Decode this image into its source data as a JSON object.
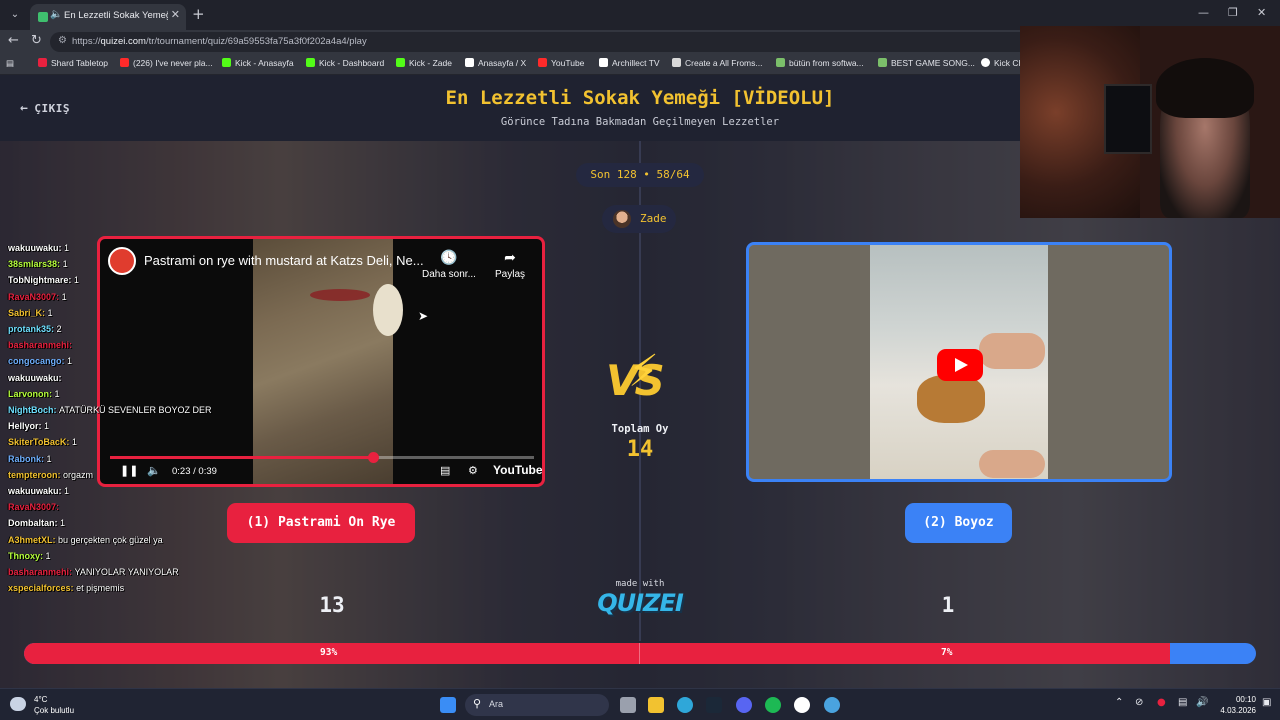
{
  "browser": {
    "tab_title": "En Lezzetli Sokak Yemeği [VİDEOLU]",
    "url_prefix": "https://",
    "url_host": "quizei.com",
    "url_path": "/tr/tournament/quiz/69a59553fa75a3f0f202a4a4/play",
    "bookmarks": [
      "Shard Tabletop",
      "(226) I've never pla...",
      "Kick - Anasayfa",
      "Kick - Dashboard",
      "Kick - Zade",
      "Anasayfa / X",
      "YouTube",
      "Archillect TV",
      "Create a All Froms...",
      "bütün from softwa...",
      "BEST GAME SONG...",
      "Kick Ch"
    ]
  },
  "header": {
    "exit_label": "ÇIKIŞ",
    "title": "En Lezzetli Sokak Yemeği [VİDEOLU]",
    "subtitle": "Görünce Tadına Bakmadan Geçilmeyen Lezzetler"
  },
  "round": {
    "label": "Son 128 • 58/64"
  },
  "user": {
    "name": "Zade"
  },
  "vs": {
    "label": "VS",
    "total_label": "Toplam Oy",
    "total_value": "14"
  },
  "left": {
    "video_title": "Pastrami on rye with mustard at Katzs Deli, Ne...",
    "later_label": "Daha sonr...",
    "share_label": "Paylaş",
    "time": "0:23 / 0:39",
    "progress": 0.62,
    "yt_label": "YouTube",
    "choice_label": "(1) Pastrami On Rye",
    "votes": "13",
    "percent": "93%",
    "color": "#e8213f"
  },
  "right": {
    "choice_label": "(2) Boyoz",
    "votes": "1",
    "percent": "7%",
    "color": "#3b82f6"
  },
  "result": {
    "left_fraction": 0.93
  },
  "branding": {
    "made_with": "made with",
    "logo": "QUIZEI"
  },
  "chat": [
    {
      "user": "wakuuwaku:",
      "msg": "1",
      "color": "#ffffff"
    },
    {
      "user": "38smlars38:",
      "msg": "1",
      "color": "#b6ff3c"
    },
    {
      "user": "TobNightmare:",
      "msg": "1",
      "color": "#ffffff"
    },
    {
      "user": "RavaN3007:",
      "msg": "1",
      "color": "#e8213f"
    },
    {
      "user": "Sabri_K:",
      "msg": "1",
      "color": "#f2c230"
    },
    {
      "user": "protank35:",
      "msg": "2",
      "color": "#6fe0ff"
    },
    {
      "user": "basharanmehi:",
      "msg": "",
      "color": "#e8213f"
    },
    {
      "user": "congocango:",
      "msg": "1",
      "color": "#6fb0ff"
    },
    {
      "user": "wakuuwaku:",
      "msg": "",
      "color": "#ffffff"
    },
    {
      "user": "Larvonon:",
      "msg": "1",
      "color": "#b6ff3c"
    },
    {
      "user": "NightBoch:",
      "msg": "ATATÜRKÜ SEVENLER BOYOZ DER",
      "color": "#6fe0ff"
    },
    {
      "user": "Hellyor:",
      "msg": "1",
      "color": "#ffffff"
    },
    {
      "user": "SkiterToBacK:",
      "msg": "1",
      "color": "#f2c230"
    },
    {
      "user": "Rabonk:",
      "msg": "1",
      "color": "#6fb0ff"
    },
    {
      "user": "tempteroon:",
      "msg": "orgazm",
      "color": "#f2c230"
    },
    {
      "user": "wakuuwaku:",
      "msg": "1",
      "color": "#ffffff"
    },
    {
      "user": "RavaN3007:",
      "msg": "",
      "color": "#e8213f"
    },
    {
      "user": "Dombaltan:",
      "msg": "1",
      "color": "#ffffff"
    },
    {
      "user": "A3hmetXL:",
      "msg": "bu gerçekten çok güzel ya",
      "color": "#f2c230"
    },
    {
      "user": "Thnoxy:",
      "msg": "1",
      "color": "#b6ff3c"
    },
    {
      "user": "basharanmehi:",
      "msg": "YANIYOLAR YANIYOLAR",
      "color": "#e8213f"
    },
    {
      "user": "xspecialforces:",
      "msg": "et pişmemis",
      "color": "#f2c230"
    }
  ],
  "taskbar": {
    "weather_temp": "4°C",
    "weather_desc": "Çok bulutlu",
    "search_label": "Ara",
    "time": "00:10",
    "date": "4.03.2026"
  }
}
